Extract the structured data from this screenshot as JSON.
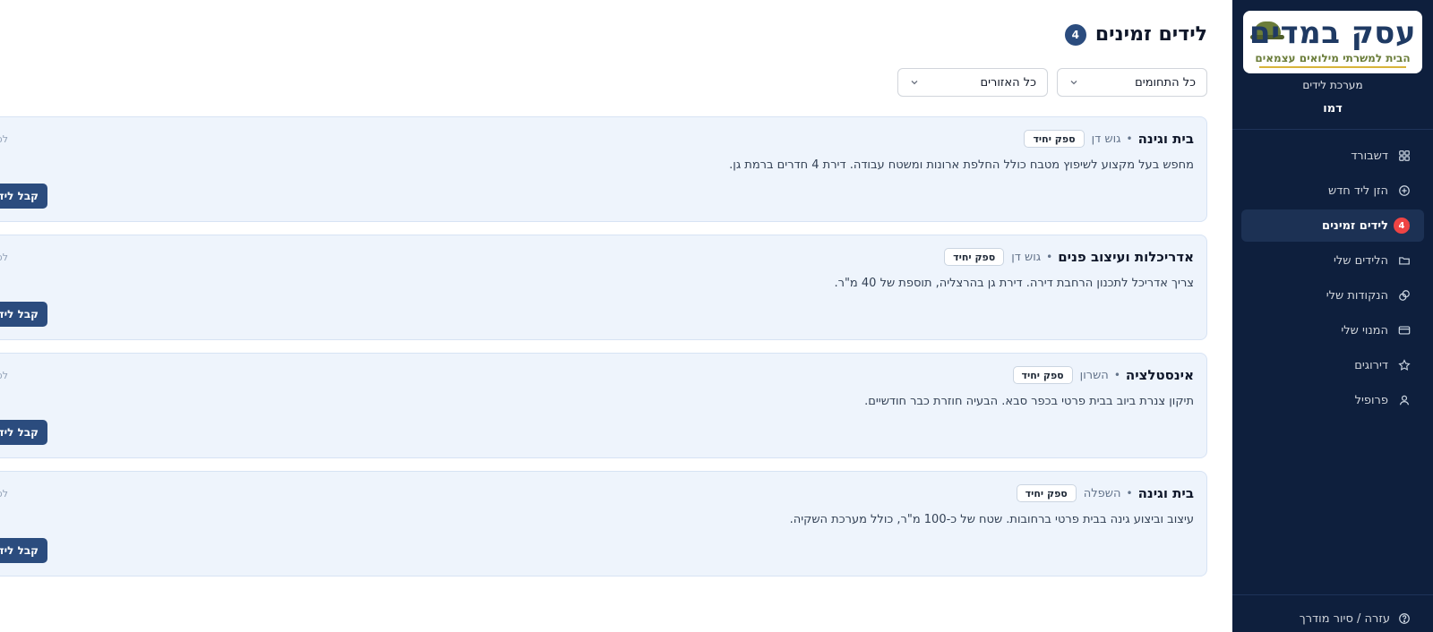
{
  "sidebar": {
    "logo_title": "עסק במדים",
    "logo_subtitle": "הבית למשרתי מילואים עצמאים",
    "system_label": "מערכת לידים",
    "user_name": "דמו",
    "items": [
      {
        "label": "דשבורד",
        "icon": "grid-icon"
      },
      {
        "label": "הזן ליד חדש",
        "icon": "plus-circle-icon"
      },
      {
        "label": "לידים זמינים",
        "icon": "list-icon",
        "badge": "4",
        "active": true
      },
      {
        "label": "הלידים שלי",
        "icon": "folder-icon"
      },
      {
        "label": "הנקודות שלי",
        "icon": "coins-icon"
      },
      {
        "label": "המנוי שלי",
        "icon": "credit-card-icon"
      },
      {
        "label": "דירוגים",
        "icon": "star-icon"
      },
      {
        "label": "פרופיל",
        "icon": "user-icon"
      }
    ],
    "help_label": "עזרה / סיור מודרך"
  },
  "main": {
    "title": "לידים זמינים",
    "count": "4",
    "filters": {
      "category": "כל התחומים",
      "region": "כל האזורים"
    },
    "leads": [
      {
        "title": "בית וגינה",
        "region": "גוש דן",
        "tag": "ספק יחיד",
        "description": "מחפש בעל מקצוע לשיפוץ מטבח כולל החלפת ארונות ומשטח עבודה. דירת 4 חדרים ברמת גן.",
        "time": "לפני",
        "button": "קבל ליד"
      },
      {
        "title": "אדריכלות ועיצוב פנים",
        "region": "גוש דן",
        "tag": "ספק יחיד",
        "description": "צריך אדריכל לתכנון הרחבת דירה. דירת גן בהרצליה, תוספת של 40 מ\"ר.",
        "time": "לפני",
        "button": "קבל ליד"
      },
      {
        "title": "אינסטלציה",
        "region": "השרון",
        "tag": "ספק יחיד",
        "description": "תיקון צנרת ביוב בבית פרטי בכפר סבא. הבעיה חוזרת כבר חודשיים.",
        "time": "לפני",
        "button": "קבל ליד"
      },
      {
        "title": "בית וגינה",
        "region": "השפלה",
        "tag": "ספק יחיד",
        "description": "עיצוב וביצוע גינה בבית פרטי ברחובות. שטח של כ-100 מ\"ר, כולל מערכת השקיה.",
        "time": "לפני",
        "button": "קבל ליד"
      }
    ]
  },
  "colors": {
    "sidebar_bg": "#0e1f3d",
    "accent": "#2b4c7e",
    "badge": "#ef4444",
    "card_bg": "#eef4fc"
  }
}
